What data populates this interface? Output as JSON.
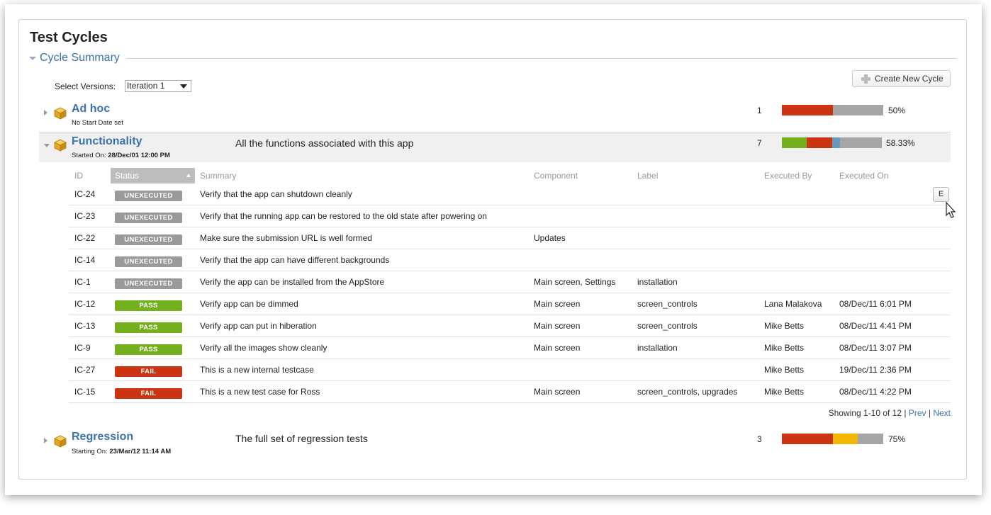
{
  "page": {
    "title": "Test Cycles",
    "section": "Cycle Summary"
  },
  "versions": {
    "label": "Select Versions:",
    "selected": "Iteration 1"
  },
  "create_button": {
    "label": "Create New Cycle"
  },
  "colors": {
    "pass": "#74b01e",
    "fail": "#cc3311",
    "unexecuted": "#9a9a9a",
    "wip": "#f2b705",
    "blocked": "#6699bb",
    "link": "#3b73af"
  },
  "cycles": [
    {
      "name": "Ad hoc",
      "sub_prefix": "No Start Date set",
      "sub_value": "",
      "description": "",
      "count": "1",
      "percent": "50%",
      "progress": [
        {
          "color": "#cc3311",
          "fraction": 0.5
        },
        {
          "color": "#a6a6a6",
          "fraction": 0.5
        }
      ]
    },
    {
      "name": "Functionality",
      "sub_prefix": "Started On: ",
      "sub_value": "28/Dec/01 12:00 PM",
      "description": "All the functions associated with this app",
      "count": "7",
      "percent": "58.33%",
      "progress": [
        {
          "color": "#74b01e",
          "fraction": 0.25
        },
        {
          "color": "#cc3311",
          "fraction": 0.25
        },
        {
          "color": "#6699bb",
          "fraction": 0.083
        },
        {
          "color": "#a6a6a6",
          "fraction": 0.417
        }
      ]
    },
    {
      "name": "Regression",
      "sub_prefix": "Starting On: ",
      "sub_value": "23/Mar/12 11:14 AM",
      "description": "The full set of regression tests",
      "count": "3",
      "percent": "75%",
      "progress": [
        {
          "color": "#cc3311",
          "fraction": 0.5
        },
        {
          "color": "#f2b705",
          "fraction": 0.25
        },
        {
          "color": "#a6a6a6",
          "fraction": 0.25
        }
      ]
    }
  ],
  "executions": {
    "columns": {
      "id": "ID",
      "status": "Status",
      "summary": "Summary",
      "component": "Component",
      "label": "Label",
      "executed_by": "Executed By",
      "executed_on": "Executed On"
    },
    "rows": [
      {
        "id": "IC-24",
        "status": "UNEXECUTED",
        "summary": "Verify that the app can shutdown cleanly",
        "component": "",
        "label": "",
        "executed_by": "",
        "executed_on": ""
      },
      {
        "id": "IC-23",
        "status": "UNEXECUTED",
        "summary": "Verify that the running app can be restored to the old state after powering on",
        "component": "",
        "label": "",
        "executed_by": "",
        "executed_on": ""
      },
      {
        "id": "IC-22",
        "status": "UNEXECUTED",
        "summary": "Make sure the submission URL is well formed",
        "component": "Updates",
        "label": "",
        "executed_by": "",
        "executed_on": ""
      },
      {
        "id": "IC-14",
        "status": "UNEXECUTED",
        "summary": "Verify that the app can have different backgrounds",
        "component": "",
        "label": "",
        "executed_by": "",
        "executed_on": ""
      },
      {
        "id": "IC-1",
        "status": "UNEXECUTED",
        "summary": "Verify the app can be installed from the AppStore",
        "component": "Main screen, Settings",
        "label": "installation",
        "executed_by": "",
        "executed_on": ""
      },
      {
        "id": "IC-12",
        "status": "PASS",
        "summary": "Verify app can be dimmed",
        "component": "Main screen",
        "label": "screen_controls",
        "executed_by": "Lana Malakova",
        "executed_on": "08/Dec/11 6:01 PM"
      },
      {
        "id": "IC-13",
        "status": "PASS",
        "summary": "Verify app can put in hiberation",
        "component": "Main screen",
        "label": "screen_controls",
        "executed_by": "Mike Betts",
        "executed_on": "08/Dec/11 4:41 PM"
      },
      {
        "id": "IC-9",
        "status": "PASS",
        "summary": "Verify all the images show cleanly",
        "component": "Main screen",
        "label": "installation",
        "executed_by": "Mike Betts",
        "executed_on": "08/Dec/11 3:07 PM"
      },
      {
        "id": "IC-27",
        "status": "FAIL",
        "summary": "This is a new internal testcase",
        "component": "",
        "label": "",
        "executed_by": "Mike Betts",
        "executed_on": "19/Dec/11 2:36 PM"
      },
      {
        "id": "IC-15",
        "status": "FAIL",
        "summary": "This is a new test case for Ross",
        "component": "Main screen",
        "label": "screen_controls, upgrades",
        "executed_by": "Mike Betts",
        "executed_on": "08/Dec/11 4:22 PM"
      }
    ],
    "row_action_label": "E"
  },
  "pager": {
    "showing": "Showing 1-10 of 12",
    "sep1": " | ",
    "prev": "Prev",
    "sep2": " | ",
    "next": "Next"
  }
}
